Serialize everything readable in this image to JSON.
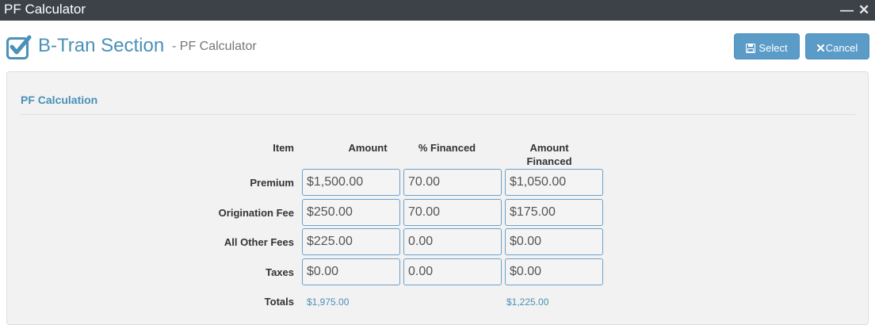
{
  "window": {
    "title": "PF Calculator",
    "minimize_glyph": "—",
    "close_glyph": "✕"
  },
  "header": {
    "title": "B-Tran Section",
    "subtitle": "- PF Calculator"
  },
  "toolbar": {
    "select_label": "Select",
    "cancel_label": "Cancel"
  },
  "colors": {
    "accent": "#4a90b8",
    "button": "#5b9bc8",
    "titlebar": "#3d4148"
  },
  "panel": {
    "title": "PF Calculation",
    "columns": {
      "item": "Item",
      "amount": "Amount",
      "pct_financed": "% Financed",
      "amount_financed_1": "Amount",
      "amount_financed_2": "Financed"
    },
    "rows": [
      {
        "label": "Premium",
        "amount": "$1,500.00",
        "pct": "70.00",
        "financed": "$1,050.00"
      },
      {
        "label": "Origination Fee",
        "amount": "$250.00",
        "pct": "70.00",
        "financed": "$175.00"
      },
      {
        "label": "All Other Fees",
        "amount": "$225.00",
        "pct": "0.00",
        "financed": "$0.00"
      },
      {
        "label": "Taxes",
        "amount": "$0.00",
        "pct": "0.00",
        "financed": "$0.00"
      }
    ],
    "totals": {
      "label": "Totals",
      "amount": "$1,975.00",
      "financed": "$1,225.00"
    }
  },
  "icons": {
    "header": "checkbox-checked-icon",
    "select": "floppy-disk-icon",
    "cancel": "x-icon"
  }
}
